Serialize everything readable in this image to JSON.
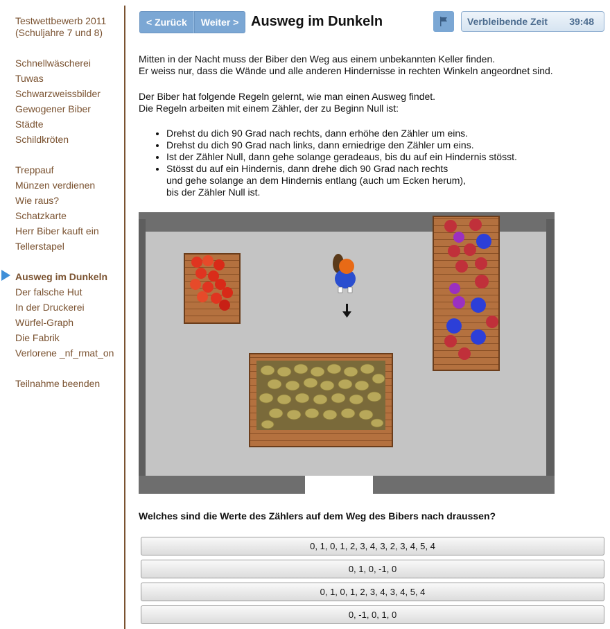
{
  "sidebar": {
    "contest_title_line1": "Testwettbewerb 2011",
    "contest_title_line2": "(Schuljahre 7 und 8)",
    "group1": [
      "Schnellwäscherei",
      "Tuwas",
      "Schwarzweissbilder",
      "Gewogener Biber",
      "Städte",
      "Schildkröten"
    ],
    "group2": [
      "Treppauf",
      "Münzen verdienen",
      "Wie raus?",
      "Schatzkarte",
      "Herr Biber kauft ein",
      "Tellerstapel"
    ],
    "group3": [
      "Ausweg im Dunkeln",
      "Der falsche Hut",
      "In der Druckerei",
      "Würfel-Graph",
      "Die Fabrik",
      "Verlorene _nf_rmat_on"
    ],
    "finish": "Teilnahme beenden",
    "active_item": "Ausweg im Dunkeln"
  },
  "header": {
    "back_label": "< Zurück",
    "next_label": "Weiter >",
    "title": "Ausweg im Dunkeln",
    "flag_icon": "flag-icon",
    "timer_label": "Verbleibende Zeit",
    "timer_value": "39:48"
  },
  "content": {
    "para1_line1": "Mitten in der Nacht muss der Biber den Weg aus einem unbekannten Keller finden.",
    "para1_line2": "Er weiss nur, dass die Wände und alle anderen Hindernisse in rechten Winkeln angeordnet sind.",
    "para2_line1": "Der Biber hat folgende Regeln gelernt, wie man einen Ausweg findet.",
    "para2_line2": "Die Regeln arbeiten mit einem Zähler, der zu Beginn Null ist:",
    "rules": [
      "Drehst du dich 90 Grad nach rechts, dann erhöhe den Zähler um eins.",
      "Drehst du dich 90 Grad nach links, dann erniedrige den Zähler um eins.",
      "Ist der Zähler Null, dann gehe solange geradeaus, bis du auf ein Hindernis stösst."
    ],
    "rule4_line1": "Stösst du auf ein Hindernis, dann drehe dich 90 Grad nach rechts",
    "rule4_line2": "und gehe solange an dem Hindernis entlang (auch um Ecken herum),",
    "rule4_line3": "bis der Zähler Null ist.",
    "question": "Welches sind die Werte des Zählers auf dem Weg des Bibers nach draussen?"
  },
  "answers": [
    "0, 1, 0, 1, 2, 3, 4, 3, 2, 3, 4, 5, 4",
    "0, 1, 0, -1, 0",
    "0, 1, 0, 1, 2, 3, 4, 3, 4, 5, 4",
    "0, -1, 0, 1, 0"
  ],
  "colors": {
    "brown": "#7a5230",
    "accent_blue": "#7ba7d4",
    "floor": "#c4c4c4",
    "wall": "#6e6e6e"
  }
}
